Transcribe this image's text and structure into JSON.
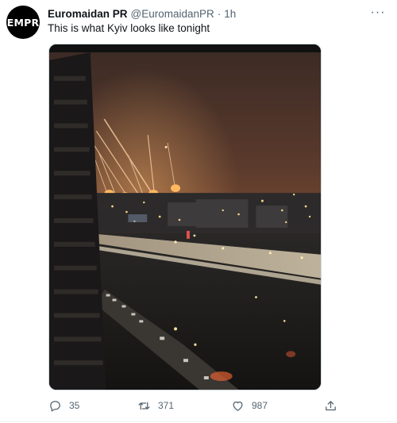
{
  "author": {
    "avatar_text": "EMPR",
    "display_name": "Euromaidan PR",
    "handle": "@EuromaidanPR",
    "separator": "·",
    "time": "1h"
  },
  "more_menu": "···",
  "tweet": {
    "text": "This is what Kyiv looks like tonight"
  },
  "media": {
    "icon": "photo"
  },
  "actions": {
    "replies": "35",
    "retweets": "371",
    "likes": "987"
  },
  "colors": {
    "text_primary": "#0f1419",
    "text_secondary": "#536471",
    "avatar_bg": "#000000",
    "border": "#cfd9de"
  }
}
